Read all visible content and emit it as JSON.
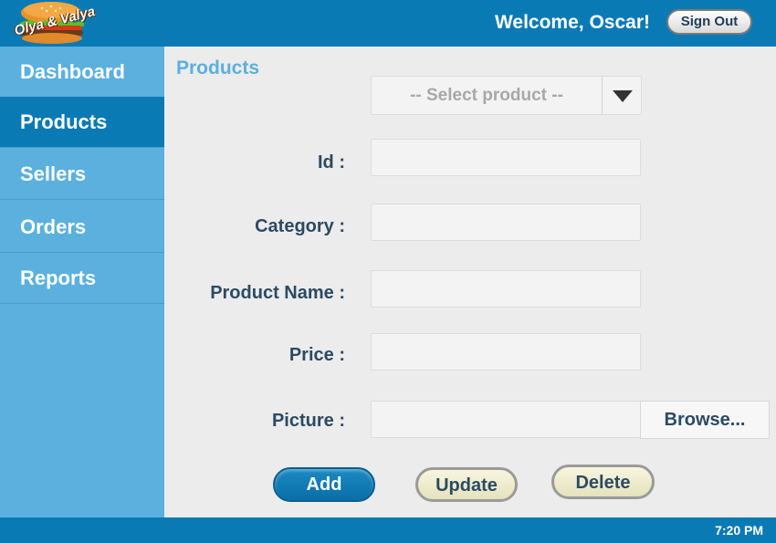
{
  "header": {
    "logo_text": "Olya & Valya",
    "welcome": "Welcome, Oscar!",
    "signout_label": "Sign Out"
  },
  "sidebar": {
    "items": [
      {
        "label": "Dashboard",
        "active": false
      },
      {
        "label": "Products",
        "active": true
      },
      {
        "label": "Sellers",
        "active": false
      },
      {
        "label": "Orders",
        "active": false
      },
      {
        "label": "Reports",
        "active": false
      }
    ]
  },
  "main": {
    "title": "Products",
    "product_select": {
      "selected": "-- Select product --"
    },
    "fields": {
      "id": {
        "label": "Id :",
        "value": ""
      },
      "category": {
        "label": "Category :",
        "value": ""
      },
      "product_name": {
        "label": "Product Name :",
        "value": ""
      },
      "price": {
        "label": "Price :",
        "value": ""
      },
      "picture": {
        "label": "Picture :",
        "value": "",
        "browse_label": "Browse..."
      }
    },
    "buttons": {
      "add": "Add",
      "update": "Update",
      "delete": "Delete"
    }
  },
  "footer": {
    "time": "7:20 PM"
  },
  "colors": {
    "primary": "#0a7ab5",
    "sidebar": "#5bb0de",
    "title": "#5bb0de",
    "label": "#2c4a63",
    "background": "#ececec"
  }
}
